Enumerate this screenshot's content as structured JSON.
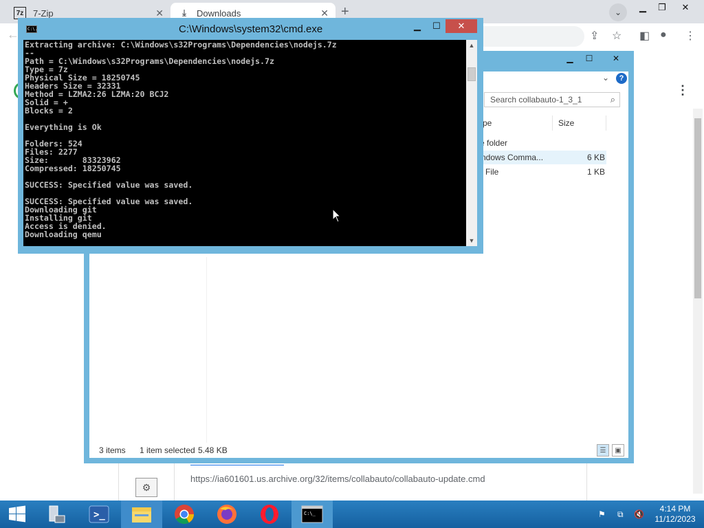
{
  "browser": {
    "tabs": [
      {
        "label": "7-Zip",
        "icon": "7zip-icon"
      },
      {
        "label": "Downloads",
        "icon": "download-icon"
      }
    ],
    "download_url": "https://ia601601.us.archive.org/32/items/collabauto/collabauto-update.cmd"
  },
  "explorer": {
    "search_placeholder": "Search collabauto-1_3_1",
    "columns": [
      "pe",
      "Size"
    ],
    "rows": [
      {
        "type": "e folder",
        "size": ""
      },
      {
        "type": "ndows Comma...",
        "size": "6 KB"
      },
      {
        "type": "File",
        "size": "1 KB"
      }
    ],
    "status": {
      "items": "3 items",
      "selected": "1 item selected",
      "selected_size": "5.48 KB"
    }
  },
  "cmd": {
    "title": "C:\\Windows\\system32\\cmd.exe",
    "icon_text": "C:\\.",
    "lines": [
      "Extracting archive: C:\\Windows\\s32Programs\\Dependencies\\nodejs.7z",
      "--",
      "Path = C:\\Windows\\s32Programs\\Dependencies\\nodejs.7z",
      "Type = 7z",
      "Physical Size = 18250745",
      "Headers Size = 32331",
      "Method = LZMA2:26 LZMA:20 BCJ2",
      "Solid = +",
      "Blocks = 2",
      "",
      "Everything is Ok",
      "",
      "Folders: 524",
      "Files: 2277",
      "Size:       83323962",
      "Compressed: 18250745",
      "",
      "SUCCESS: Specified value was saved.",
      "",
      "SUCCESS: Specified value was saved.",
      "Downloading git",
      "Installing git",
      "Access is denied.",
      "Downloading qemu",
      "_"
    ]
  },
  "taskbar": {
    "items": [
      "start-button",
      "server-manager-icon",
      "powershell-icon",
      "file-explorer-icon",
      "chrome-icon",
      "firefox-icon",
      "opera-icon",
      "cmd-icon"
    ],
    "clock_time": "4:14 PM",
    "clock_date": "11/12/2023"
  },
  "colors": {
    "window_frame": "#6fb6dc",
    "close_red": "#c7504b",
    "taskbar": "#1b6aa8"
  }
}
